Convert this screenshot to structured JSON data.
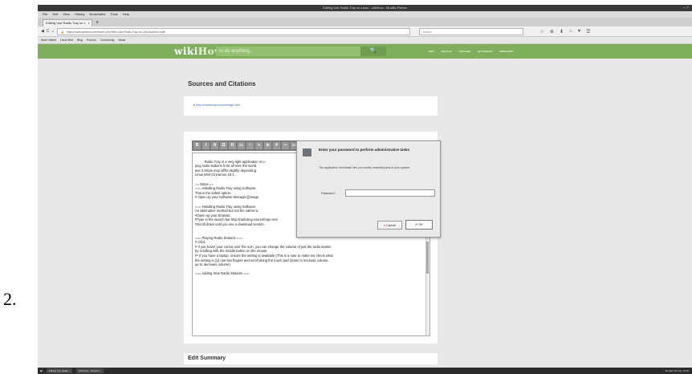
{
  "step_number": "2.",
  "window": {
    "title": "Editing Use Radio Tray on Linux - wikiHow - Mozilla Firefox",
    "controls": "– ×"
  },
  "menu": [
    "File",
    "Edit",
    "View",
    "History",
    "Bookmarks",
    "Tools",
    "Help"
  ],
  "tab": {
    "label": "Editing Use Radio Tray on L",
    "close": "×"
  },
  "new_tab": "+",
  "nav": {
    "back": "◀",
    "reload": "C",
    "home": "⌂",
    "url": "https://www.wikihow.com/index.php?title=Use-Radio-Tray-on-Linux&action=edit",
    "search_placeholder": "Search",
    "icons": [
      "☆",
      "⊕",
      "⬇",
      "⌂",
      "♥",
      "☰"
    ]
  },
  "bookmarks": [
    "Most Visited",
    "Linux Mint",
    "Blog",
    "Forums",
    "Community",
    "News"
  ],
  "wikihow": {
    "logo_wiki": "wiki",
    "logo_how": "How",
    "search_placeholder": "to do anything...",
    "search_button": "🔍",
    "nav": [
      "EDIT",
      "HELP US",
      "EXPLORE",
      "MY PROFILE",
      "MESSAGES"
    ]
  },
  "sources": {
    "title": "Sources and Citations",
    "link": "▸ http://radiotray.sourceforge.net/"
  },
  "editor": {
    "toolbar": [
      "B",
      "I",
      "A",
      "Ω",
      "H",
      "▭",
      "~",
      "∿",
      "⊘",
      "#",
      "—",
      "▭",
      "▭"
    ],
    "content": "Radio Tray is a very light application in Li\nplay radio stations from all over the world.\nsee it.Steps may differ slightly depending\nLinux Mint Cinnamon 18.1.\n\n== Steps ==\n=== Installing Radio Tray using Software\nThis is the safest option.\n# Open up your Software Manager.[[Image\n\n=== Installing Radio Tray using Software\nAn alternative method but not the safest w\n#Open up your browser\n#Type in the search bar http://radiotray.sourceforge.net/\n#Scroll down until you see a download section\n\n\n=== Playing Radio Stations ===\n# Click\n# If you hover your cursor over the icon, you can change the volume of just the radio station\nby scrolling with the middle button on the mouse.\n#* If you have a laptop, ensure the setting is available (This is a note to make me check what\nthe setting is.)))) use two fingers and scroll along the touch pad (down to increase volume,\nup to decrease volume)\n\n=== Adding New Radio Stations ==="
  },
  "dialog": {
    "title": "Enter your password to perform administrative tasks",
    "body": "The application 'mintinstall' lets you modify essential parts of your system.",
    "password_label": "Password:",
    "cancel": "Cancel",
    "ok": "OK"
  },
  "summary": {
    "title": "Edit Summary"
  },
  "taskbar": {
    "tasks": [
      "Editing Use Radio...",
      "[Pictures - Browsin..."
    ],
    "clock": "Sunday 18 July, 10:09"
  }
}
